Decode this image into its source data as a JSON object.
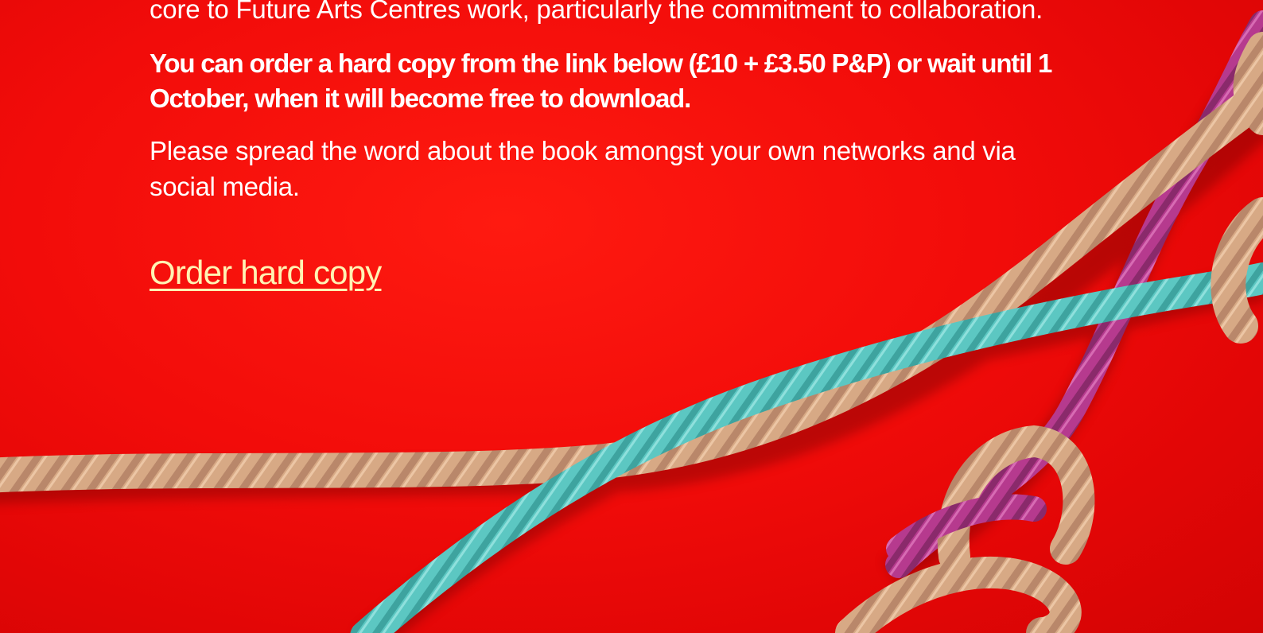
{
  "content": {
    "intro_line": "core to Future Arts Centres work, particularly the commitment to collaboration.",
    "order_info": "You can order a hard copy from the link below (£10 + £3.50 P&P) or wait until 1 October, when it will become free to download.",
    "spread_word": "Please spread the word about the book amongst your own networks and via social media.",
    "order_link_label": "Order hard copy"
  },
  "colors": {
    "background": "#f20c0a",
    "text": "#ffffff",
    "link": "#fff3b3",
    "rope_tan": "#d7a985",
    "rope_teal": "#5cc7c2",
    "rope_magenta": "#b63a8e"
  },
  "image": {
    "description_icon": "rope-illustration"
  }
}
